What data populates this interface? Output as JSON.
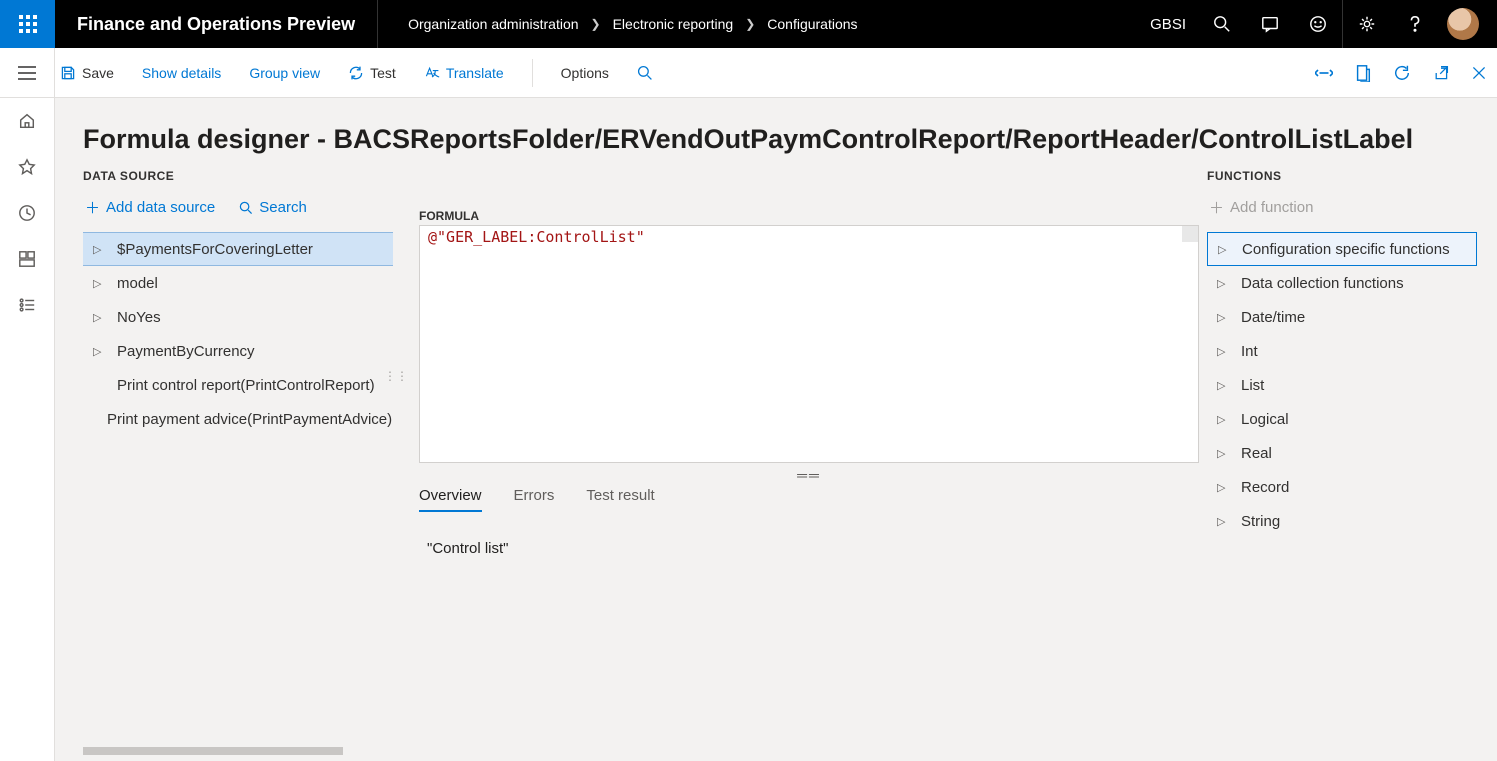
{
  "header": {
    "app_title": "Finance and Operations Preview",
    "breadcrumbs": [
      "Organization administration",
      "Electronic reporting",
      "Configurations"
    ],
    "company": "GBSI"
  },
  "toolbar": {
    "save": "Save",
    "show_details": "Show details",
    "group_view": "Group view",
    "test": "Test",
    "translate": "Translate",
    "options": "Options"
  },
  "page": {
    "title": "Formula designer - BACSReportsFolder/ERVendOutPaymControlReport/ReportHeader/ControlListLabel"
  },
  "datasource": {
    "label": "DATA SOURCE",
    "add": "Add data source",
    "search": "Search",
    "tree": [
      {
        "label": "$PaymentsForCoveringLetter",
        "expandable": true,
        "selected": true
      },
      {
        "label": "model",
        "expandable": true
      },
      {
        "label": "NoYes",
        "expandable": true
      },
      {
        "label": "PaymentByCurrency",
        "expandable": true
      },
      {
        "label": "Print control report(PrintControlReport)",
        "expandable": false
      },
      {
        "label": "Print payment advice(PrintPaymentAdvice)",
        "expandable": false
      }
    ]
  },
  "formula": {
    "label": "FORMULA",
    "text": "@\"GER_LABEL:ControlList\""
  },
  "tabs": {
    "items": [
      "Overview",
      "Errors",
      "Test result"
    ],
    "active": 0
  },
  "overview": {
    "value": "\"Control list\""
  },
  "functions": {
    "label": "FUNCTIONS",
    "add": "Add function",
    "tree": [
      {
        "label": "Configuration specific functions",
        "selected": true
      },
      {
        "label": "Data collection functions"
      },
      {
        "label": "Date/time"
      },
      {
        "label": "Int"
      },
      {
        "label": "List"
      },
      {
        "label": "Logical"
      },
      {
        "label": "Real"
      },
      {
        "label": "Record"
      },
      {
        "label": "String"
      }
    ]
  }
}
